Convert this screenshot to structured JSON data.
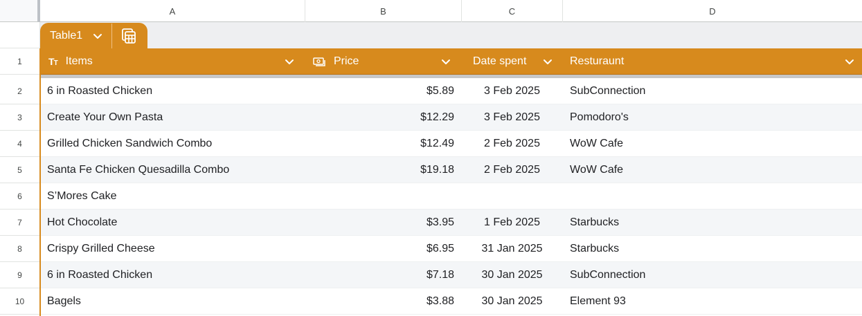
{
  "columns": [
    "A",
    "B",
    "C",
    "D"
  ],
  "table": {
    "name": "Table1",
    "headers": {
      "items": "Items",
      "price": "Price",
      "date": "Date spent",
      "restaurant": "Resturaunt"
    }
  },
  "rows": [
    {
      "num": "2",
      "item": "6 in Roasted Chicken",
      "price": "$5.89",
      "date": "3 Feb 2025",
      "restaurant": "SubConnection"
    },
    {
      "num": "3",
      "item": "Create Your Own Pasta",
      "price": "$12.29",
      "date": "3 Feb 2025",
      "restaurant": "Pomodoro's"
    },
    {
      "num": "4",
      "item": "Grilled Chicken Sandwich Combo",
      "price": "$12.49",
      "date": "2 Feb 2025",
      "restaurant": "WoW Cafe"
    },
    {
      "num": "5",
      "item": "Santa Fe Chicken Quesadilla Combo",
      "price": "$19.18",
      "date": "2 Feb 2025",
      "restaurant": "WoW Cafe"
    },
    {
      "num": "6",
      "item": "S’Mores Cake",
      "price": "",
      "date": "",
      "restaurant": ""
    },
    {
      "num": "7",
      "item": "Hot Chocolate",
      "price": "$3.95",
      "date": "1 Feb 2025",
      "restaurant": "Starbucks"
    },
    {
      "num": "8",
      "item": "Crispy Grilled Cheese",
      "price": "$6.95",
      "date": "31 Jan 2025",
      "restaurant": "Starbucks"
    },
    {
      "num": "9",
      "item": "6 in Roasted Chicken",
      "price": "$7.18",
      "date": "30 Jan 2025",
      "restaurant": "SubConnection"
    },
    {
      "num": "10",
      "item": "Bagels",
      "price": "$3.88",
      "date": "30 Jan 2025",
      "restaurant": "Element 93"
    }
  ],
  "header_row_number": "1",
  "colors": {
    "accent": "#d78a1d",
    "header_text": "#ffffff",
    "grid": "#e1e3e1"
  }
}
